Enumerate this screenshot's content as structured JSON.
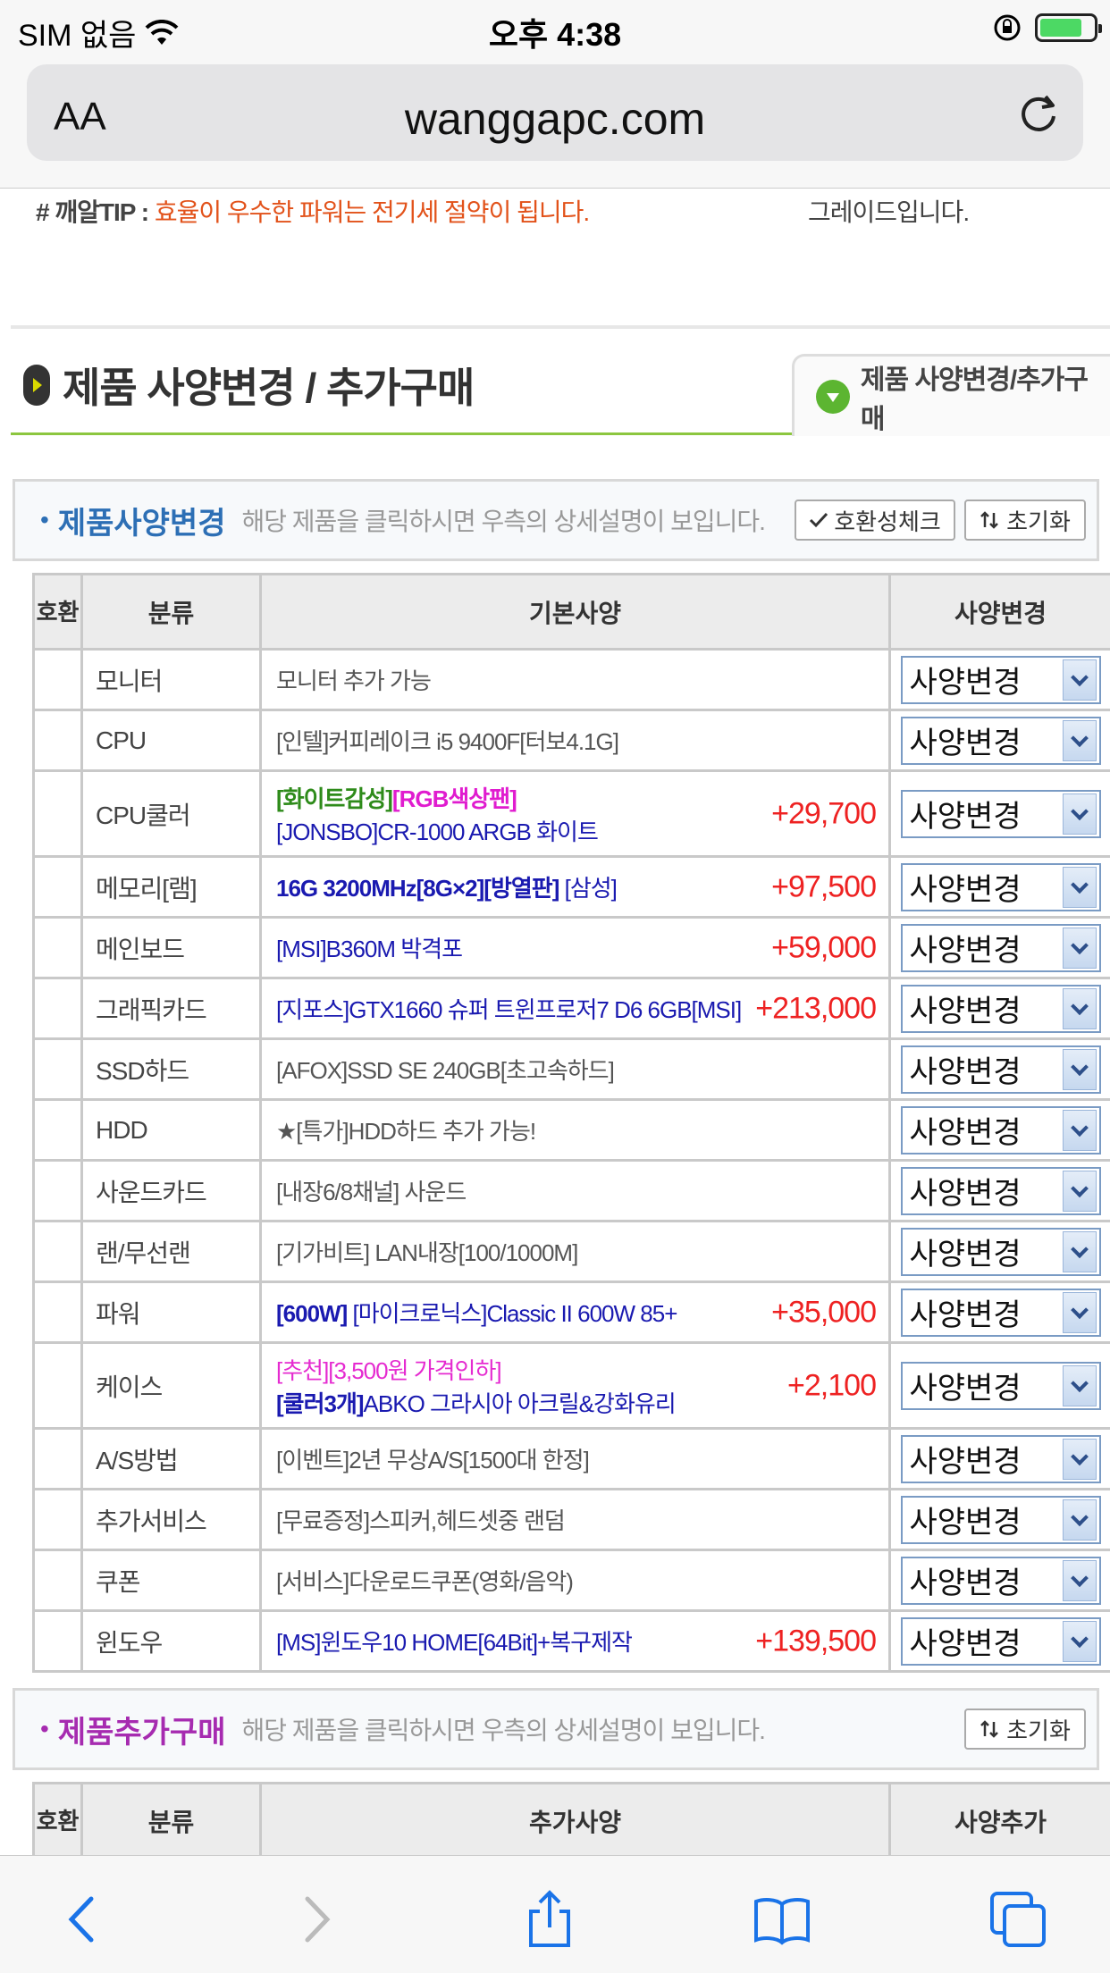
{
  "status": {
    "carrier": "SIM 없음",
    "time": "오후 4:38",
    "battery_level": 0.8,
    "battery_color": "#4cd964"
  },
  "browser": {
    "text_size_label": "AA",
    "url": "wanggapc.com",
    "icons": [
      "reload-icon",
      "back-icon",
      "forward-icon",
      "share-icon",
      "bookmarks-icon",
      "tabs-icon"
    ]
  },
  "tip": {
    "key": "# 깨알TIP :",
    "text": "효율이 우수한 파워는 전기세 절약이 됩니다.",
    "right_text": "그레이드입니다."
  },
  "section": {
    "title": "제품 사양변경 / 추가구매",
    "tab_label": "제품 사양변경/추가구매"
  },
  "spec_panel": {
    "dot": "•",
    "heading": "제품사양변경",
    "desc": "해당 제품을 클릭하시면 우측의 상세설명이 보입니다.",
    "compat_btn": "호환성체크",
    "reset_btn": "초기화",
    "heading_color": "#2d6fb5"
  },
  "spec_table": {
    "headers": {
      "compat": "호환",
      "category": "분류",
      "basic": "기본사양",
      "change": "사양변경"
    },
    "select_label": "사양변경",
    "rows": [
      {
        "category": "모니터",
        "line1": "모니터 추가 가능",
        "price": ""
      },
      {
        "category": "CPU",
        "line1": "[인텔]커피레이크 i5 9400F[터보4.1G]",
        "price": ""
      },
      {
        "category": "CPU쿨러",
        "tag1": "[화이트감성]",
        "tag2": "[RGB색상팬]",
        "line2": "[JONSBO]CR-1000 ARGB 화이트",
        "price": "+29,700"
      },
      {
        "category": "메모리[램]",
        "bold": "16G 3200MHz[8G×2][방열판]",
        "line1": " [삼성]",
        "price": "+97,500"
      },
      {
        "category": "메인보드",
        "line1": "[MSI]B360M 박격포",
        "price": "+59,000"
      },
      {
        "category": "그래픽카드",
        "line1": "[지포스]GTX1660 슈퍼 트윈프로저7 D6 6GB[MSI]",
        "price": "+213,000"
      },
      {
        "category": "SSD하드",
        "line1": "[AFOX]SSD SE 240GB[초고속하드]",
        "price": ""
      },
      {
        "category": "HDD",
        "line1": "★[특가]HDD하드 추가 가능!",
        "price": ""
      },
      {
        "category": "사운드카드",
        "line1": "[내장6/8채널] 사운드",
        "price": ""
      },
      {
        "category": "랜/무선랜",
        "line1": "[기가비트] LAN내장[100/1000M]",
        "price": ""
      },
      {
        "category": "파워",
        "bold": "[600W]",
        "line1": " [마이크로닉스]Classic II 600W 85+",
        "price": "+35,000"
      },
      {
        "category": "케이스",
        "tag1": "[추천][3,500원 가격인하]",
        "bold": "[쿨러3개]",
        "line2": "ABKO 그라시아 아크릴&강화유리",
        "price": "+2,100"
      },
      {
        "category": "A/S방법",
        "line1": "[이벤트]2년 무상A/S[1500대 한정]",
        "price": ""
      },
      {
        "category": "추가서비스",
        "line1": "[무료증정]스피커,헤드셋중 랜덤",
        "price": ""
      },
      {
        "category": "쿠폰",
        "line1": "[서비스]다운로드쿠폰(영화/음악)",
        "price": ""
      },
      {
        "category": "윈도우",
        "line1": "[MS]윈도우10 HOME[64Bit]+복구제작",
        "price": "+139,500"
      }
    ]
  },
  "add_panel": {
    "dot": "•",
    "heading": "제품추가구매",
    "desc": "해당 제품을 클릭하시면 우측의 상세설명이 보입니다.",
    "reset_btn": "초기화",
    "heading_color": "#a62bb0"
  },
  "add_table": {
    "headers": {
      "compat": "호환",
      "category": "분류",
      "basic": "추가사양",
      "change": "사양추가"
    }
  }
}
